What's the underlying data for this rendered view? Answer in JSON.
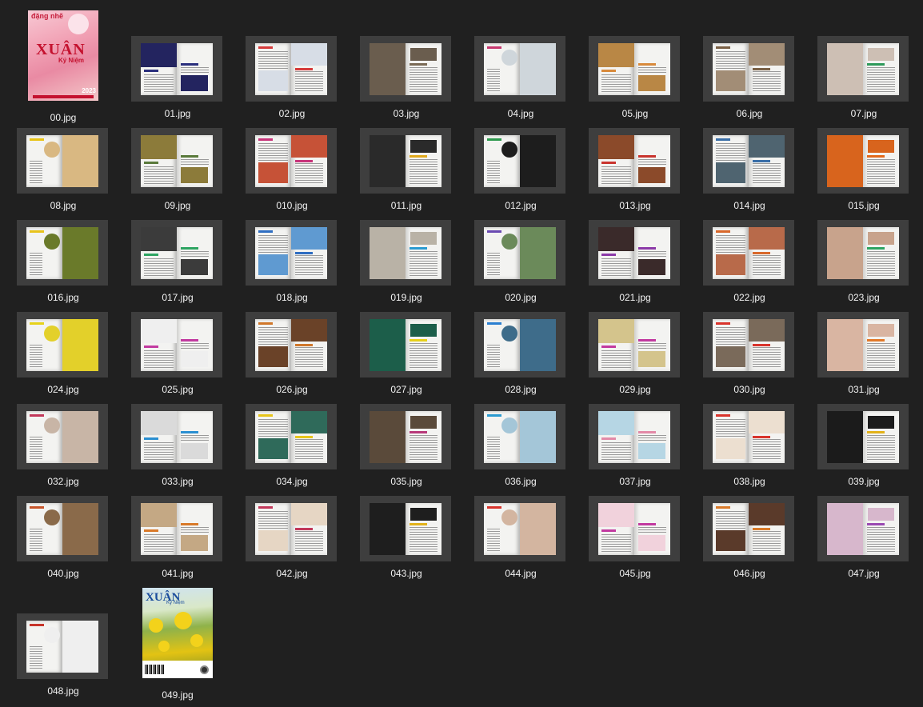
{
  "window": {
    "background": "#202020",
    "label_color": "#f2f2f2"
  },
  "front_cover": {
    "filename": "00.jpg",
    "brand": "đặng nhẽ",
    "title": "XUÂN",
    "subtitle": "Ký Niệm",
    "year": "2023"
  },
  "back_cover": {
    "filename": "049.jpg",
    "title": "XUÂN",
    "subtitle": "Ký Niệm"
  },
  "files": [
    {
      "name": "01.jpg",
      "accent": "#2a2f7d",
      "image": "#23245f"
    },
    {
      "name": "02.jpg",
      "accent": "#d63b3b",
      "image": "#d7dde6"
    },
    {
      "name": "03.jpg",
      "accent": "#7a6a55",
      "image": "#6a5d4e"
    },
    {
      "name": "04.jpg",
      "accent": "#c7386f",
      "image": "#cfd6db"
    },
    {
      "name": "05.jpg",
      "accent": "#d88a3c",
      "image": "#b98745"
    },
    {
      "name": "06.jpg",
      "accent": "#7a6045",
      "image": "#a28d76"
    },
    {
      "name": "07.jpg",
      "accent": "#2e9a5a",
      "image": "#cdbfb4"
    },
    {
      "name": "08.jpg",
      "accent": "#e8c314",
      "image": "#d9b882"
    },
    {
      "name": "09.jpg",
      "accent": "#5a7a3b",
      "image": "#8c7b3a"
    },
    {
      "name": "010.jpg",
      "accent": "#c8347a",
      "image": "#c65237"
    },
    {
      "name": "011.jpg",
      "accent": "#e0a91e",
      "image": "#2a2a2a"
    },
    {
      "name": "012.jpg",
      "accent": "#2e9a4e",
      "image": "#1d1d1d"
    },
    {
      "name": "013.jpg",
      "accent": "#c9352f",
      "image": "#8b4a2a"
    },
    {
      "name": "014.jpg",
      "accent": "#3a6fa8",
      "image": "#4f6470"
    },
    {
      "name": "015.jpg",
      "accent": "#e26a1d",
      "image": "#d8641d"
    },
    {
      "name": "016.jpg",
      "accent": "#e8c31b",
      "image": "#6a7a2a"
    },
    {
      "name": "017.jpg",
      "accent": "#2ea462",
      "image": "#3b3b3b"
    },
    {
      "name": "018.jpg",
      "accent": "#2f6ec2",
      "image": "#5f9ad1"
    },
    {
      "name": "019.jpg",
      "accent": "#2b9bd1",
      "image": "#b9b2a6"
    },
    {
      "name": "020.jpg",
      "accent": "#6a4ab2",
      "image": "#6b8a5a"
    },
    {
      "name": "021.jpg",
      "accent": "#8c3aa8",
      "image": "#3a2a2a"
    },
    {
      "name": "022.jpg",
      "accent": "#d9682a",
      "image": "#b86a4a"
    },
    {
      "name": "023.jpg",
      "accent": "#2ea462",
      "image": "#c8a38c"
    },
    {
      "name": "024.jpg",
      "accent": "#e6d21a",
      "image": "#e3d02a"
    },
    {
      "name": "025.jpg",
      "accent": "#c23aa0",
      "image": "#efefef"
    },
    {
      "name": "026.jpg",
      "accent": "#d0772a",
      "image": "#6a4228"
    },
    {
      "name": "027.jpg",
      "accent": "#e7d11a",
      "image": "#1c5e4a"
    },
    {
      "name": "028.jpg",
      "accent": "#2b7fd1",
      "image": "#3e6c8a"
    },
    {
      "name": "029.jpg",
      "accent": "#c23aa0",
      "image": "#d4c48c"
    },
    {
      "name": "030.jpg",
      "accent": "#d9342c",
      "image": "#7a6a5a"
    },
    {
      "name": "031.jpg",
      "accent": "#e27a2a",
      "image": "#d9b5a2"
    },
    {
      "name": "032.jpg",
      "accent": "#c2385a",
      "image": "#c8b5a6"
    },
    {
      "name": "033.jpg",
      "accent": "#2b8fd1",
      "image": "#dadada"
    },
    {
      "name": "034.jpg",
      "accent": "#e7c51a",
      "image": "#2f6a5a"
    },
    {
      "name": "035.jpg",
      "accent": "#b8397a",
      "image": "#5a4a3a"
    },
    {
      "name": "036.jpg",
      "accent": "#2b9bd1",
      "image": "#a4c6d8"
    },
    {
      "name": "037.jpg",
      "accent": "#e38aa8",
      "image": "#b6d6e4"
    },
    {
      "name": "038.jpg",
      "accent": "#d9342c",
      "image": "#ecdfd0"
    },
    {
      "name": "039.jpg",
      "accent": "#e2b21a",
      "image": "#1b1b1b"
    },
    {
      "name": "040.jpg",
      "accent": "#c7552a",
      "image": "#8a6a4a"
    },
    {
      "name": "041.jpg",
      "accent": "#d97a2a",
      "image": "#c4a884"
    },
    {
      "name": "042.jpg",
      "accent": "#c2385a",
      "image": "#e6d6c4"
    },
    {
      "name": "043.jpg",
      "accent": "#e2b21a",
      "image": "#1e1e1e"
    },
    {
      "name": "044.jpg",
      "accent": "#d9342c",
      "image": "#d3b5a0"
    },
    {
      "name": "045.jpg",
      "accent": "#c23aa0",
      "image": "#f1d2dc"
    },
    {
      "name": "046.jpg",
      "accent": "#d97a2a",
      "image": "#5a3a2a"
    },
    {
      "name": "047.jpg",
      "accent": "#9a4ab2",
      "image": "#d7b7cc"
    },
    {
      "name": "048.jpg",
      "accent": "#c7352a",
      "image": "#efefef"
    }
  ]
}
